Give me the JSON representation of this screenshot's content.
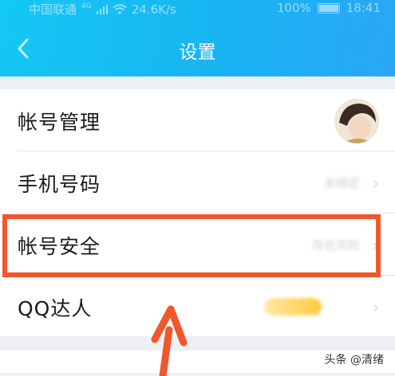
{
  "status_bar": {
    "carrier": "中国联通",
    "network": "4G",
    "speed": "24.6K/s",
    "battery": "100%",
    "time": "18:41"
  },
  "header": {
    "title": "设置",
    "back_icon": "chevron-left-icon"
  },
  "settings": {
    "rows": [
      {
        "label": "帐号管理",
        "value": ""
      },
      {
        "label": "手机号码",
        "value": "未绑定"
      },
      {
        "label": "帐号安全",
        "value": "存在风险"
      },
      {
        "label": "QQ达人",
        "value": ""
      }
    ]
  },
  "overlay": {
    "highlight_color": "#f1572b",
    "arrow_color": "#f1572b"
  },
  "watermark": {
    "text": "头条 @清绪"
  },
  "colors": {
    "header_start": "#14c8f4",
    "header_end": "#2aa6f5"
  }
}
